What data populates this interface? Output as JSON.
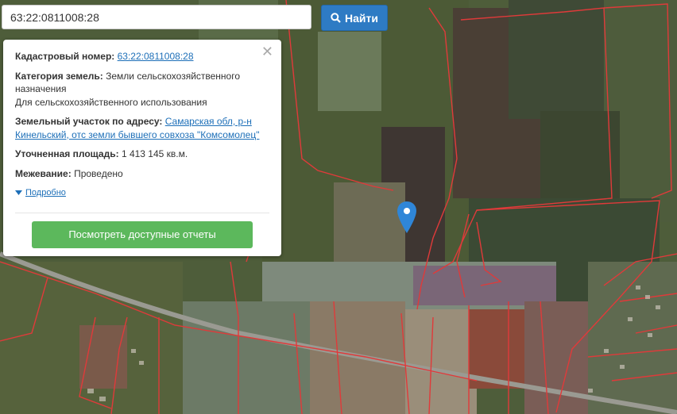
{
  "search": {
    "value": "63:22:0811008:28",
    "button_label": "Найти"
  },
  "popup": {
    "cadastral_label": "Кадастровый номер:",
    "cadastral_value": "63:22:0811008:28",
    "category_label": "Категория земель:",
    "category_value": "Земли сельскохозяйственного назначения",
    "usage_value": "Для сельскохозяйственного использования",
    "address_label": "Земельный участок по адресу:",
    "address_value": "Самарская обл, р-н Кинельский, отс земли бывшего совхоза \"Комсомолец\"",
    "area_label": "Уточненная площадь:",
    "area_value": "1 413 145 кв.м.",
    "survey_label": "Межевание:",
    "survey_value": "Проведено",
    "details_label": "Подробно",
    "reports_button": "Посмотреть доступные отчеты"
  },
  "colors": {
    "search_button": "#2e7bc4",
    "reports_button": "#5cb85c",
    "parcel_border": "#e03a3a",
    "link": "#1d6fb8",
    "marker": "#2f86d8"
  },
  "icons": {
    "search_button": "search-icon",
    "close": "close-icon",
    "details": "caret-down-icon",
    "marker": "map-marker-icon"
  }
}
